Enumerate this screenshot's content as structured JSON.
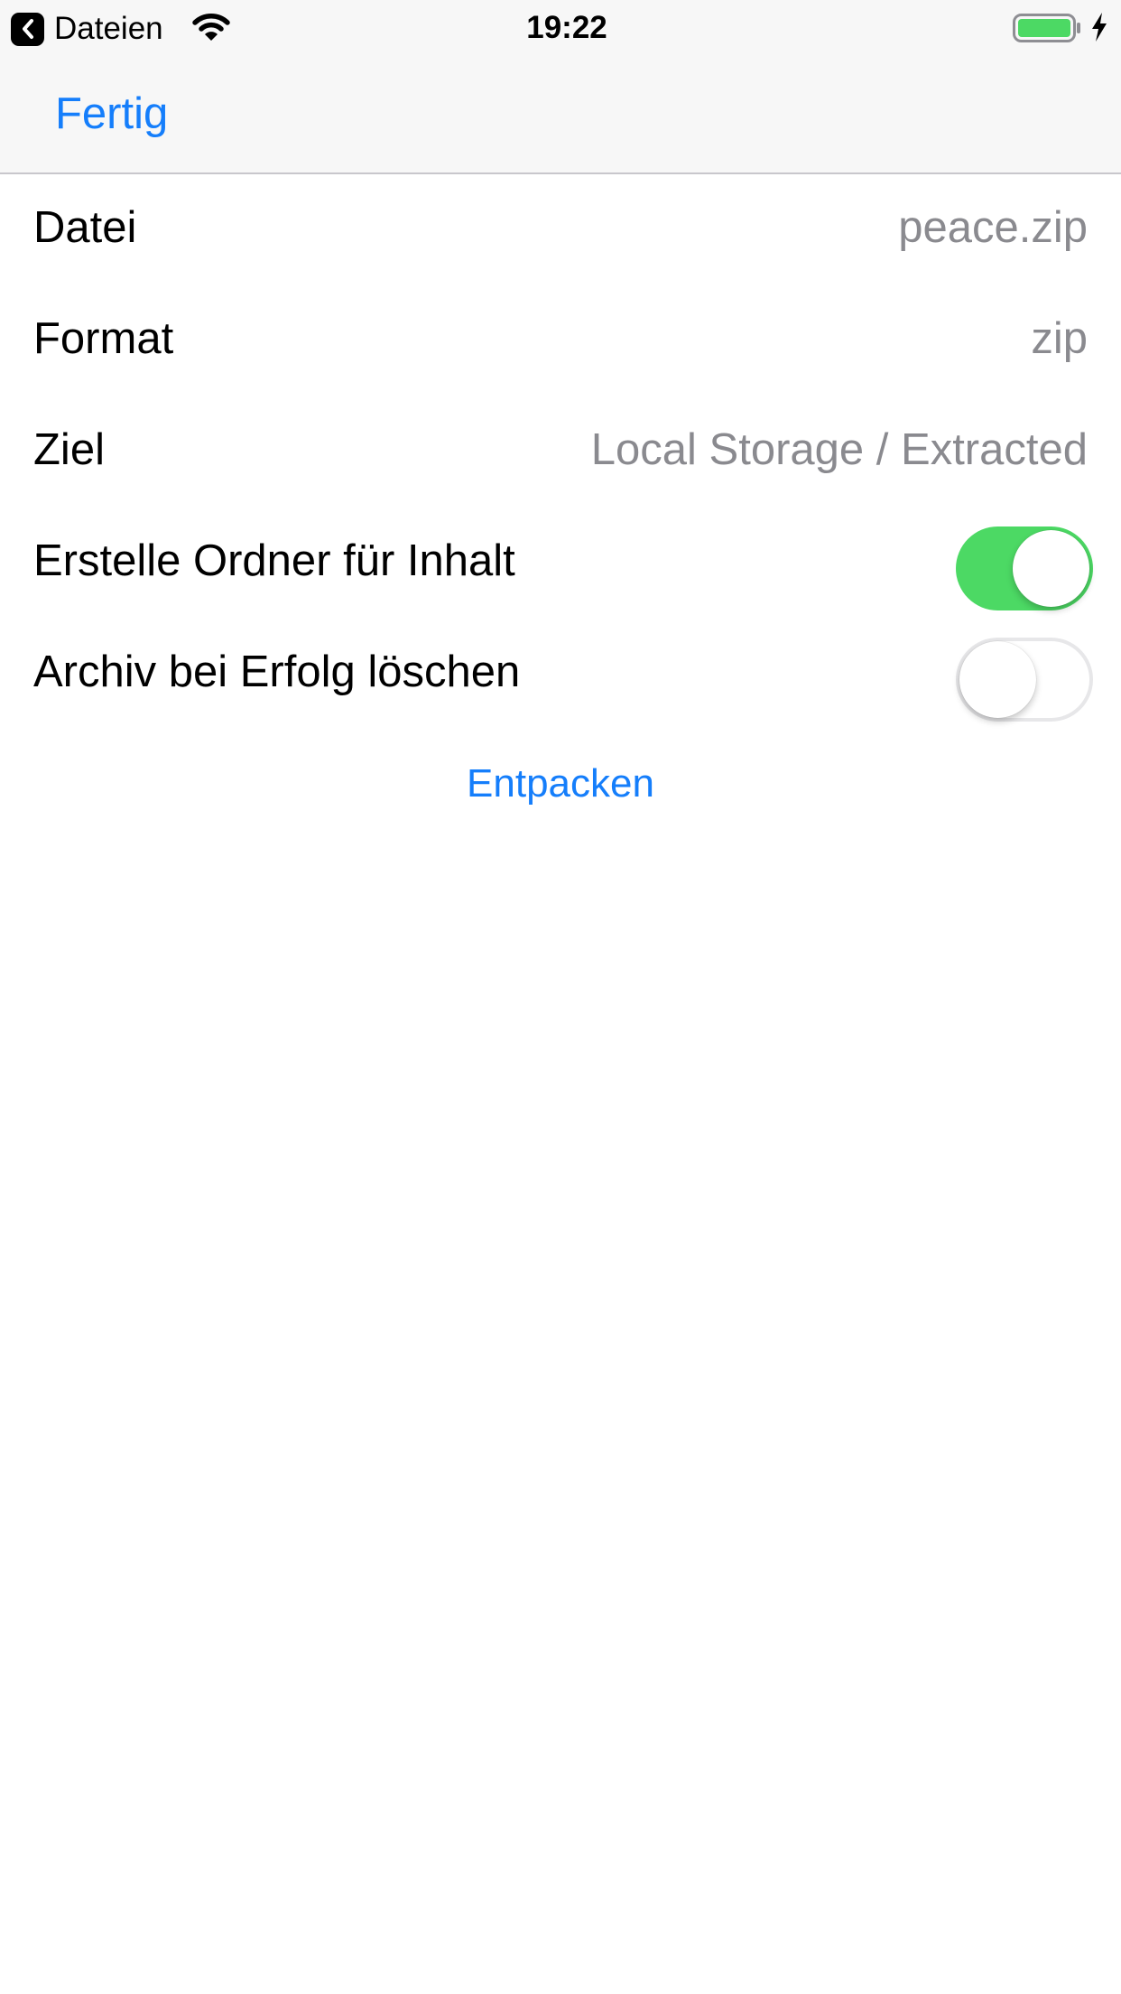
{
  "status_bar": {
    "back_app_label": "Dateien",
    "time": "19:22",
    "battery_color": "#4cd964"
  },
  "nav_bar": {
    "done_label": "Fertig",
    "accent_color": "#157efb"
  },
  "form": {
    "file_label": "Datei",
    "file_value": "peace.zip",
    "format_label": "Format",
    "format_value": "zip",
    "target_label": "Ziel",
    "target_value": "Local Storage / Extracted",
    "create_folder_label": "Erstelle Ordner für Inhalt",
    "create_folder_on": true,
    "delete_archive_label": "Archiv bei Erfolg löschen",
    "delete_archive_on": false,
    "extract_label": "Entpacken"
  }
}
